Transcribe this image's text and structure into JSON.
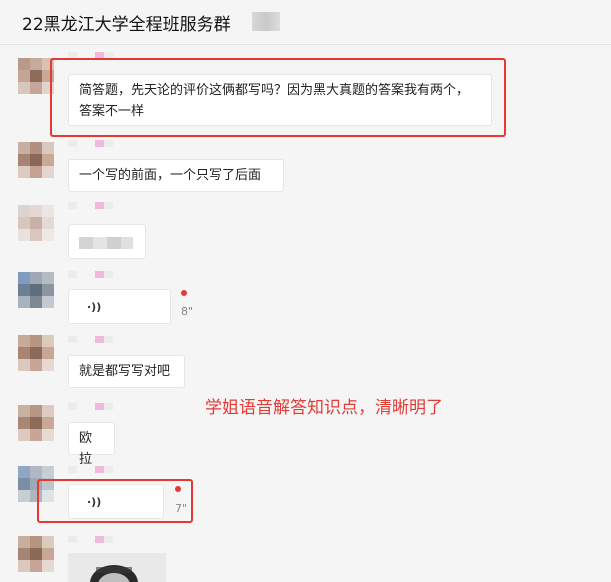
{
  "window": {
    "title": "22黑龙江大学全程班服务群"
  },
  "messages": [
    {
      "type": "text",
      "text": "简答题，先天论的评价这俩都写吗？因为黑大真题的答案我有两个，答案不一样"
    },
    {
      "type": "text",
      "text": "一个写的前面，一个只写了后面"
    },
    {
      "type": "text",
      "text": ""
    },
    {
      "type": "voice",
      "duration": "8\"",
      "unread": true
    },
    {
      "type": "text",
      "text": "就是都写写对吧"
    },
    {
      "type": "text",
      "text": "欧拉"
    },
    {
      "type": "voice",
      "duration": "7\"",
      "unread": true
    },
    {
      "type": "image"
    }
  ],
  "annotation": {
    "text": "学姐语音解答知识点，清晰明了"
  },
  "icons": {
    "voice": "voice-wave-icon"
  },
  "colors": {
    "highlight": "#e53935",
    "background": "#f5f5f5",
    "bubble": "#ffffff"
  }
}
